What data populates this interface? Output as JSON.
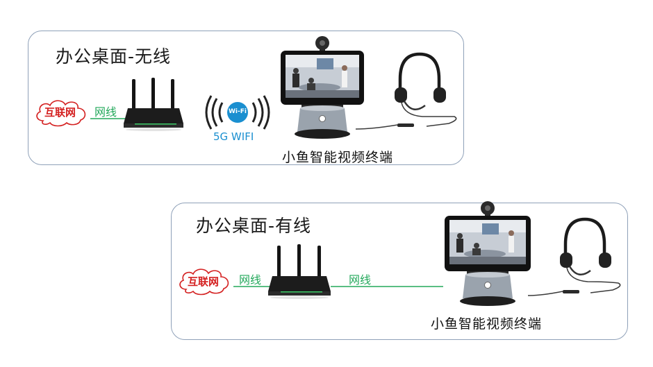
{
  "wireless": {
    "title": "办公桌面-无线",
    "cloud": "互联网",
    "cable": "网线",
    "wifi_badge": "Wi-Fi",
    "wifi_label": "5G WIFI",
    "terminal": "小鱼智能视频终端"
  },
  "wired": {
    "title": "办公桌面-有线",
    "cloud": "互联网",
    "cable1": "网线",
    "cable2": "网线",
    "terminal": "小鱼智能视频终端"
  },
  "colors": {
    "panel_border": "#8ea0b8",
    "cable_label": "#22a85a",
    "wifi_label": "#1a8fd0",
    "cloud_text": "#d42020"
  }
}
